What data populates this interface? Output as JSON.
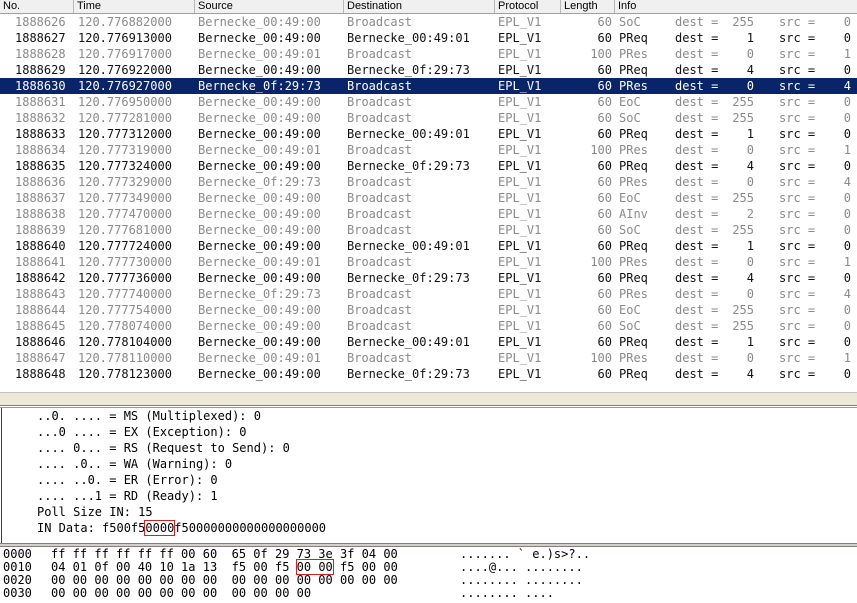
{
  "columns": {
    "no": "No.",
    "time": "Time",
    "source": "Source",
    "destination": "Destination",
    "protocol": "Protocol",
    "length": "Length",
    "info": "Info"
  },
  "packets": [
    {
      "no": "1888626",
      "time": "120.776882000",
      "src": "Bernecke_00:49:00",
      "dst": "Broadcast",
      "proto": "EPL_V1",
      "len": "60",
      "kind": "SoC",
      "dest": "255",
      "srcn": "0",
      "style": "dim"
    },
    {
      "no": "1888627",
      "time": "120.776913000",
      "src": "Bernecke_00:49:00",
      "dst": "Bernecke_00:49:01",
      "proto": "EPL_V1",
      "len": "60",
      "kind": "PReq",
      "dest": "1",
      "srcn": "0",
      "style": "normal"
    },
    {
      "no": "1888628",
      "time": "120.776917000",
      "src": "Bernecke_00:49:01",
      "dst": "Broadcast",
      "proto": "EPL_V1",
      "len": "100",
      "kind": "PRes",
      "dest": "0",
      "srcn": "1",
      "style": "dim"
    },
    {
      "no": "1888629",
      "time": "120.776922000",
      "src": "Bernecke_00:49:00",
      "dst": "Bernecke_0f:29:73",
      "proto": "EPL_V1",
      "len": "60",
      "kind": "PReq",
      "dest": "4",
      "srcn": "0",
      "style": "normal"
    },
    {
      "no": "1888630",
      "time": "120.776927000",
      "src": "Bernecke_0f:29:73",
      "dst": "Broadcast",
      "proto": "EPL_V1",
      "len": "60",
      "kind": "PRes",
      "dest": "0",
      "srcn": "4",
      "style": "selected"
    },
    {
      "no": "1888631",
      "time": "120.776950000",
      "src": "Bernecke_00:49:00",
      "dst": "Broadcast",
      "proto": "EPL_V1",
      "len": "60",
      "kind": "EoC",
      "dest": "255",
      "srcn": "0",
      "style": "dim"
    },
    {
      "no": "1888632",
      "time": "120.777281000",
      "src": "Bernecke_00:49:00",
      "dst": "Broadcast",
      "proto": "EPL_V1",
      "len": "60",
      "kind": "SoC",
      "dest": "255",
      "srcn": "0",
      "style": "dim"
    },
    {
      "no": "1888633",
      "time": "120.777312000",
      "src": "Bernecke_00:49:00",
      "dst": "Bernecke_00:49:01",
      "proto": "EPL_V1",
      "len": "60",
      "kind": "PReq",
      "dest": "1",
      "srcn": "0",
      "style": "normal"
    },
    {
      "no": "1888634",
      "time": "120.777319000",
      "src": "Bernecke_00:49:01",
      "dst": "Broadcast",
      "proto": "EPL_V1",
      "len": "100",
      "kind": "PRes",
      "dest": "0",
      "srcn": "1",
      "style": "dim"
    },
    {
      "no": "1888635",
      "time": "120.777324000",
      "src": "Bernecke_00:49:00",
      "dst": "Bernecke_0f:29:73",
      "proto": "EPL_V1",
      "len": "60",
      "kind": "PReq",
      "dest": "4",
      "srcn": "0",
      "style": "normal"
    },
    {
      "no": "1888636",
      "time": "120.777329000",
      "src": "Bernecke_0f:29:73",
      "dst": "Broadcast",
      "proto": "EPL_V1",
      "len": "60",
      "kind": "PRes",
      "dest": "0",
      "srcn": "4",
      "style": "dim"
    },
    {
      "no": "1888637",
      "time": "120.777349000",
      "src": "Bernecke_00:49:00",
      "dst": "Broadcast",
      "proto": "EPL_V1",
      "len": "60",
      "kind": "EoC",
      "dest": "255",
      "srcn": "0",
      "style": "dim"
    },
    {
      "no": "1888638",
      "time": "120.777470000",
      "src": "Bernecke_00:49:00",
      "dst": "Broadcast",
      "proto": "EPL_V1",
      "len": "60",
      "kind": "AInv",
      "dest": "2",
      "srcn": "0",
      "style": "dim"
    },
    {
      "no": "1888639",
      "time": "120.777681000",
      "src": "Bernecke_00:49:00",
      "dst": "Broadcast",
      "proto": "EPL_V1",
      "len": "60",
      "kind": "SoC",
      "dest": "255",
      "srcn": "0",
      "style": "dim"
    },
    {
      "no": "1888640",
      "time": "120.777724000",
      "src": "Bernecke_00:49:00",
      "dst": "Bernecke_00:49:01",
      "proto": "EPL_V1",
      "len": "60",
      "kind": "PReq",
      "dest": "1",
      "srcn": "0",
      "style": "normal"
    },
    {
      "no": "1888641",
      "time": "120.777730000",
      "src": "Bernecke_00:49:01",
      "dst": "Broadcast",
      "proto": "EPL_V1",
      "len": "100",
      "kind": "PRes",
      "dest": "0",
      "srcn": "1",
      "style": "dim"
    },
    {
      "no": "1888642",
      "time": "120.777736000",
      "src": "Bernecke_00:49:00",
      "dst": "Bernecke_0f:29:73",
      "proto": "EPL_V1",
      "len": "60",
      "kind": "PReq",
      "dest": "4",
      "srcn": "0",
      "style": "normal"
    },
    {
      "no": "1888643",
      "time": "120.777740000",
      "src": "Bernecke_0f:29:73",
      "dst": "Broadcast",
      "proto": "EPL_V1",
      "len": "60",
      "kind": "PRes",
      "dest": "0",
      "srcn": "4",
      "style": "dim"
    },
    {
      "no": "1888644",
      "time": "120.777754000",
      "src": "Bernecke_00:49:00",
      "dst": "Broadcast",
      "proto": "EPL_V1",
      "len": "60",
      "kind": "EoC",
      "dest": "255",
      "srcn": "0",
      "style": "dim"
    },
    {
      "no": "1888645",
      "time": "120.778074000",
      "src": "Bernecke_00:49:00",
      "dst": "Broadcast",
      "proto": "EPL_V1",
      "len": "60",
      "kind": "SoC",
      "dest": "255",
      "srcn": "0",
      "style": "dim"
    },
    {
      "no": "1888646",
      "time": "120.778104000",
      "src": "Bernecke_00:49:00",
      "dst": "Bernecke_00:49:01",
      "proto": "EPL_V1",
      "len": "60",
      "kind": "PReq",
      "dest": "1",
      "srcn": "0",
      "style": "normal"
    },
    {
      "no": "1888647",
      "time": "120.778110000",
      "src": "Bernecke_00:49:01",
      "dst": "Broadcast",
      "proto": "EPL_V1",
      "len": "100",
      "kind": "PRes",
      "dest": "0",
      "srcn": "1",
      "style": "dim"
    },
    {
      "no": "1888648",
      "time": "120.778123000",
      "src": "Bernecke_00:49:00",
      "dst": "Bernecke_0f:29:73",
      "proto": "EPL_V1",
      "len": "60",
      "kind": "PReq",
      "dest": "4",
      "srcn": "0",
      "style": "normal"
    }
  ],
  "info_labels": {
    "dest": "dest =",
    "src": "src ="
  },
  "detail": {
    "lines": [
      "..0. .... = MS (Multiplexed): 0",
      "...0 .... = EX (Exception): 0",
      ".... 0... = RS (Request to Send): 0",
      ".... .0.. = WA (Warning): 0",
      ".... ..0. = ER (Error): 0",
      ".... ...1 = RD (Ready): 1",
      "Poll Size IN: 15"
    ],
    "in_data": {
      "label": "IN Data: ",
      "pre": "f500f5",
      "mark": "0000",
      "post": "f50000000000000000000"
    }
  },
  "hex": {
    "rows": [
      {
        "offset": "0000",
        "pre": "ff ff ff ff ff ff 00 60  65 0f 29 73 3e 3f 04 00",
        "mark": "",
        "post": "",
        "ascii": "....... ` e.)s>?.."
      },
      {
        "offset": "0010",
        "pre": "04 01 0f 00 40 10 1a 13  f5 00 f5 ",
        "mark": "00 00",
        "post": " f5 00 00",
        "ascii": "....@... ........"
      },
      {
        "offset": "0020",
        "pre": "00 00 00 00 00 00 00 00  00 00 00 00 00 00 00 00",
        "mark": "",
        "post": "",
        "ascii": "........ ........"
      },
      {
        "offset": "0030",
        "pre": "00 00 00 00 00 00 00 00  00 00 00 00",
        "mark": "",
        "post": "",
        "ascii": "........ ...."
      }
    ]
  },
  "colors": {
    "selected_bg": "#0a246a",
    "dim_text": "#8a8a8a",
    "highlight_box": "#d62020"
  }
}
